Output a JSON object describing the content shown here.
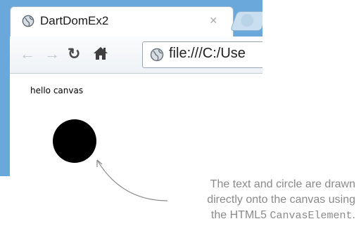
{
  "browser": {
    "tab": {
      "title": "DartDomEx2",
      "favicon_icon": "globe-icon",
      "close_label": "×"
    },
    "new_tab_icon": "new-tab-icon",
    "toolbar": {
      "back_icon": "back-arrow-icon",
      "forward_icon": "forward-arrow-icon",
      "reload_icon": "reload-icon",
      "home_icon": "home-icon"
    },
    "address_bar": {
      "icon": "globe-icon",
      "url": "file:///C:/Use"
    }
  },
  "page": {
    "text": "hello canvas",
    "circle_color": "#000000"
  },
  "annotation": {
    "line1": "The text and circle are drawn",
    "line2": "directly onto the canvas using",
    "line3_prefix": "the HTML5 ",
    "line3_code": "CanvasElement",
    "line3_suffix": "."
  }
}
